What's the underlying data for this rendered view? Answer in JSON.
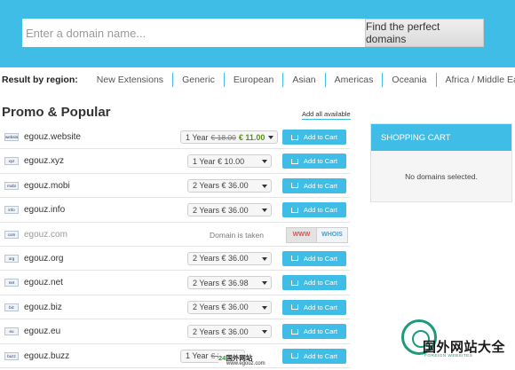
{
  "search": {
    "placeholder": "Enter a domain name...",
    "button_label": "Find the perfect domains"
  },
  "regions": {
    "label": "Result by region:",
    "items": [
      "New Extensions",
      "Generic",
      "European",
      "Asian",
      "Americas",
      "Oceania",
      "Africa / Middle East"
    ]
  },
  "promo": {
    "title": "Promo & Popular",
    "add_all": "Add all available"
  },
  "domains": [
    {
      "tld": "website",
      "name": "egouz.website",
      "period": "1 Year",
      "old_price": "€ 18.00",
      "price": "€ 11.00",
      "action": "Add to Cart"
    },
    {
      "tld": "xyz",
      "name": "egouz.xyz",
      "period": "1 Year",
      "price": "€ 10.00",
      "action": "Add to Cart"
    },
    {
      "tld": "mobi",
      "name": "egouz.mobi",
      "period": "2 Years",
      "price": "€ 36.00",
      "action": "Add to Cart"
    },
    {
      "tld": "info",
      "name": "egouz.info",
      "period": "2 Years",
      "price": "€ 36.00",
      "action": "Add to Cart"
    },
    {
      "tld": "com",
      "name": "egouz.com",
      "status": "Domain is taken",
      "www": "WWW",
      "whois": "WHOIS"
    },
    {
      "tld": "org",
      "name": "egouz.org",
      "period": "2 Years",
      "price": "€ 36.00",
      "action": "Add to Cart"
    },
    {
      "tld": "net",
      "name": "egouz.net",
      "period": "2 Years",
      "price": "€ 36.98",
      "action": "Add to Cart"
    },
    {
      "tld": "biz",
      "name": "egouz.biz",
      "period": "2 Years",
      "price": "€ 36.00",
      "action": "Add to Cart"
    },
    {
      "tld": "eu",
      "name": "egouz.eu",
      "period": "2 Years",
      "price": "€ 36.00",
      "action": "Add to Cart"
    },
    {
      "tld": "buzz",
      "name": "egouz.buzz",
      "period": "1 Year",
      "old_price": "€ 30.0",
      "price": "",
      "action": "Add to Cart"
    }
  ],
  "cart": {
    "title": "SHOPPING CART",
    "empty_text": "No domains selected."
  },
  "watermark": {
    "title": "国外网站大全",
    "subtitle": "FOREIGN WEBSITES",
    "bottom_prefix": "24",
    "bottom_text": "国外网站",
    "url": "www.egouz.com"
  },
  "colors": {
    "accent": "#3fbde6",
    "sale_price": "#5a8f1c",
    "www_red": "#d9534f"
  }
}
